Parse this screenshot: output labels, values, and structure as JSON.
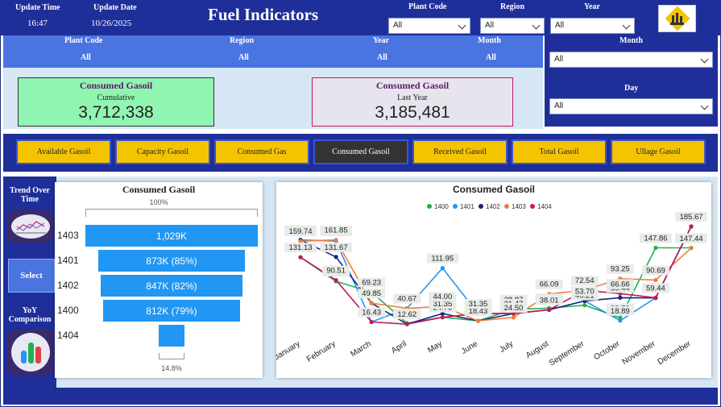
{
  "header": {
    "update_time_label": "Update Time",
    "update_time": "16:47",
    "update_date_label": "Update Date",
    "update_date": "10/26/2025",
    "title": "Fuel Indicators",
    "plant_code_label": "Plant Code",
    "plant_code_value": "All",
    "region_label": "Region",
    "region_value": "All",
    "year_label": "Year",
    "year_value": "All"
  },
  "filter_summary": {
    "plant_code_label": "Plant Code",
    "plant_code_value": "All",
    "region_label": "Region",
    "region_value": "All",
    "year_label": "Year",
    "year_value": "All",
    "month_label": "Month",
    "month_value": "All"
  },
  "right_filters": {
    "month_label": "Month",
    "month_value": "All",
    "day_label": "Day",
    "day_value": "All"
  },
  "kpis": {
    "cumulative": {
      "title": "Consumed Gasoil",
      "subtitle": "Cumulative",
      "value": "3,712,338",
      "color": "#90f5b0"
    },
    "last_year": {
      "title": "Consumed Gasoil",
      "subtitle": "Last Year",
      "value": "3,185,481",
      "color": "#e8e4ee"
    }
  },
  "tabs": [
    {
      "label": "Available Gasoil",
      "active": false
    },
    {
      "label": "Capacity Gasoil",
      "active": false
    },
    {
      "label": "Consumed Gas",
      "active": false
    },
    {
      "label": "Consumed Gasoil",
      "active": true
    },
    {
      "label": "Received Gasoil",
      "active": false
    },
    {
      "label": "Total Gasoil",
      "active": false
    },
    {
      "label": "Ullage Gasoil",
      "active": false
    }
  ],
  "left_nav": {
    "trend_label": "Trend Over Time",
    "select_label": "Select",
    "yoy_label": "YoY Comparison"
  },
  "funnel": {
    "title": "Consumed Gasoil",
    "top_pct": "100%",
    "bottom_pct": "14.8%",
    "rows": [
      {
        "category": "1403",
        "label": "1,029K",
        "fraction": 1.0
      },
      {
        "category": "1401",
        "label": "873K (85%)",
        "fraction": 0.85
      },
      {
        "category": "1402",
        "label": "847K (82%)",
        "fraction": 0.82
      },
      {
        "category": "1400",
        "label": "812K (79%)",
        "fraction": 0.79
      },
      {
        "category": "1404",
        "label": "",
        "fraction": 0.148
      }
    ]
  },
  "chart_data": {
    "type": "line",
    "title": "Consumed Gasoil",
    "categories": [
      "January",
      "February",
      "March",
      "April",
      "May",
      "June",
      "July",
      "August",
      "September",
      "October",
      "November",
      "December"
    ],
    "series": [
      {
        "name": "1400",
        "color": "#22b14c",
        "values": [
          131.13,
          88.58,
          69.23,
          14.28,
          24.75,
          18.43,
          38.87,
          40.88,
          46.21,
          23.72,
          147.86,
          147.86
        ]
      },
      {
        "name": "1401",
        "color": "#2196f3",
        "values": [
          161.85,
          159.74,
          16.43,
          40.67,
          111.95,
          31.35,
          31.47,
          38.01,
          53.7,
          18.89,
          59.11,
          185.67
        ]
      },
      {
        "name": "1402",
        "color": "#1a237e",
        "values": [
          161.85,
          131.67,
          49.85,
          12.62,
          31.35,
          18.43,
          31.47,
          38.01,
          53.7,
          59.44,
          59.11,
          185.67
        ]
      },
      {
        "name": "1403",
        "color": "#f07c3c",
        "values": [
          159.74,
          161.85,
          49.85,
          40.67,
          44.0,
          18.43,
          24.5,
          66.09,
          72.54,
          93.25,
          90.69,
          147.44
        ]
      },
      {
        "name": "1404",
        "color": "#c2185b",
        "values": [
          131.13,
          90.51,
          16.43,
          12.62,
          24.75,
          31.35,
          31.47,
          38.01,
          72.54,
          66.66,
          59.44,
          185.67
        ]
      }
    ],
    "ylim": [
      0,
      200
    ]
  }
}
